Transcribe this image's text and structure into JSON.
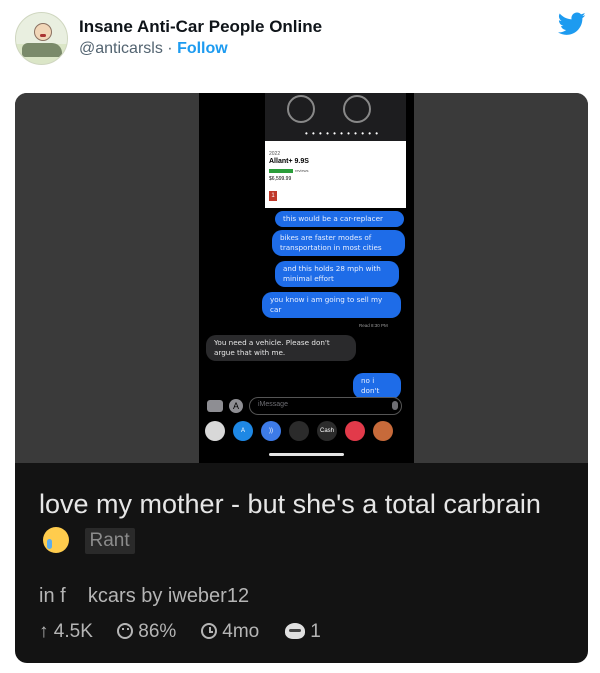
{
  "tweet": {
    "account_name": "Insane Anti-Car People Online",
    "handle": "@anticarsls",
    "separator": "·",
    "follow_label": "Follow",
    "brand_color": "#1d9bf0"
  },
  "screenshot": {
    "product": {
      "dots": "• • • • • • • • • • •",
      "year": "2022",
      "title": "Allant+ 9.9S",
      "reviews": "reviews",
      "price": "$6,599.99",
      "right_text": "",
      "note": "",
      "badge": "1"
    },
    "messages": [
      {
        "from": "me",
        "text": "this would be a car-replacer"
      },
      {
        "from": "me",
        "text": "bikes are faster modes of transportation in most cities"
      },
      {
        "from": "me",
        "text": "and this holds 28 mph with minimal effort"
      },
      {
        "from": "me",
        "text": "you know i am going to sell my car"
      },
      {
        "from": "them",
        "text": "You need a vehicle. Please don't argue that with me."
      },
      {
        "from": "me",
        "text": "no i don't"
      }
    ],
    "read_receipt": "Read 8:30 PM",
    "compose_placeholder": "iMessage",
    "app_icons": [
      "contact-photo",
      "app-store",
      "audio",
      "pay",
      "cash",
      "images",
      "memoji"
    ],
    "cash_label": "Cash"
  },
  "post": {
    "title": "love my mother - but she's a total carbrain",
    "flair": "Rant",
    "meta": "in f    kcars by iweber12",
    "upvotes_icon": "↑",
    "upvotes": "4.5K",
    "ratio": "86%",
    "age": "4mo",
    "awards": "1",
    "colors": {
      "card_bg": "#131313",
      "text": "#e6e6e6",
      "muted": "#b5b5b5"
    }
  }
}
